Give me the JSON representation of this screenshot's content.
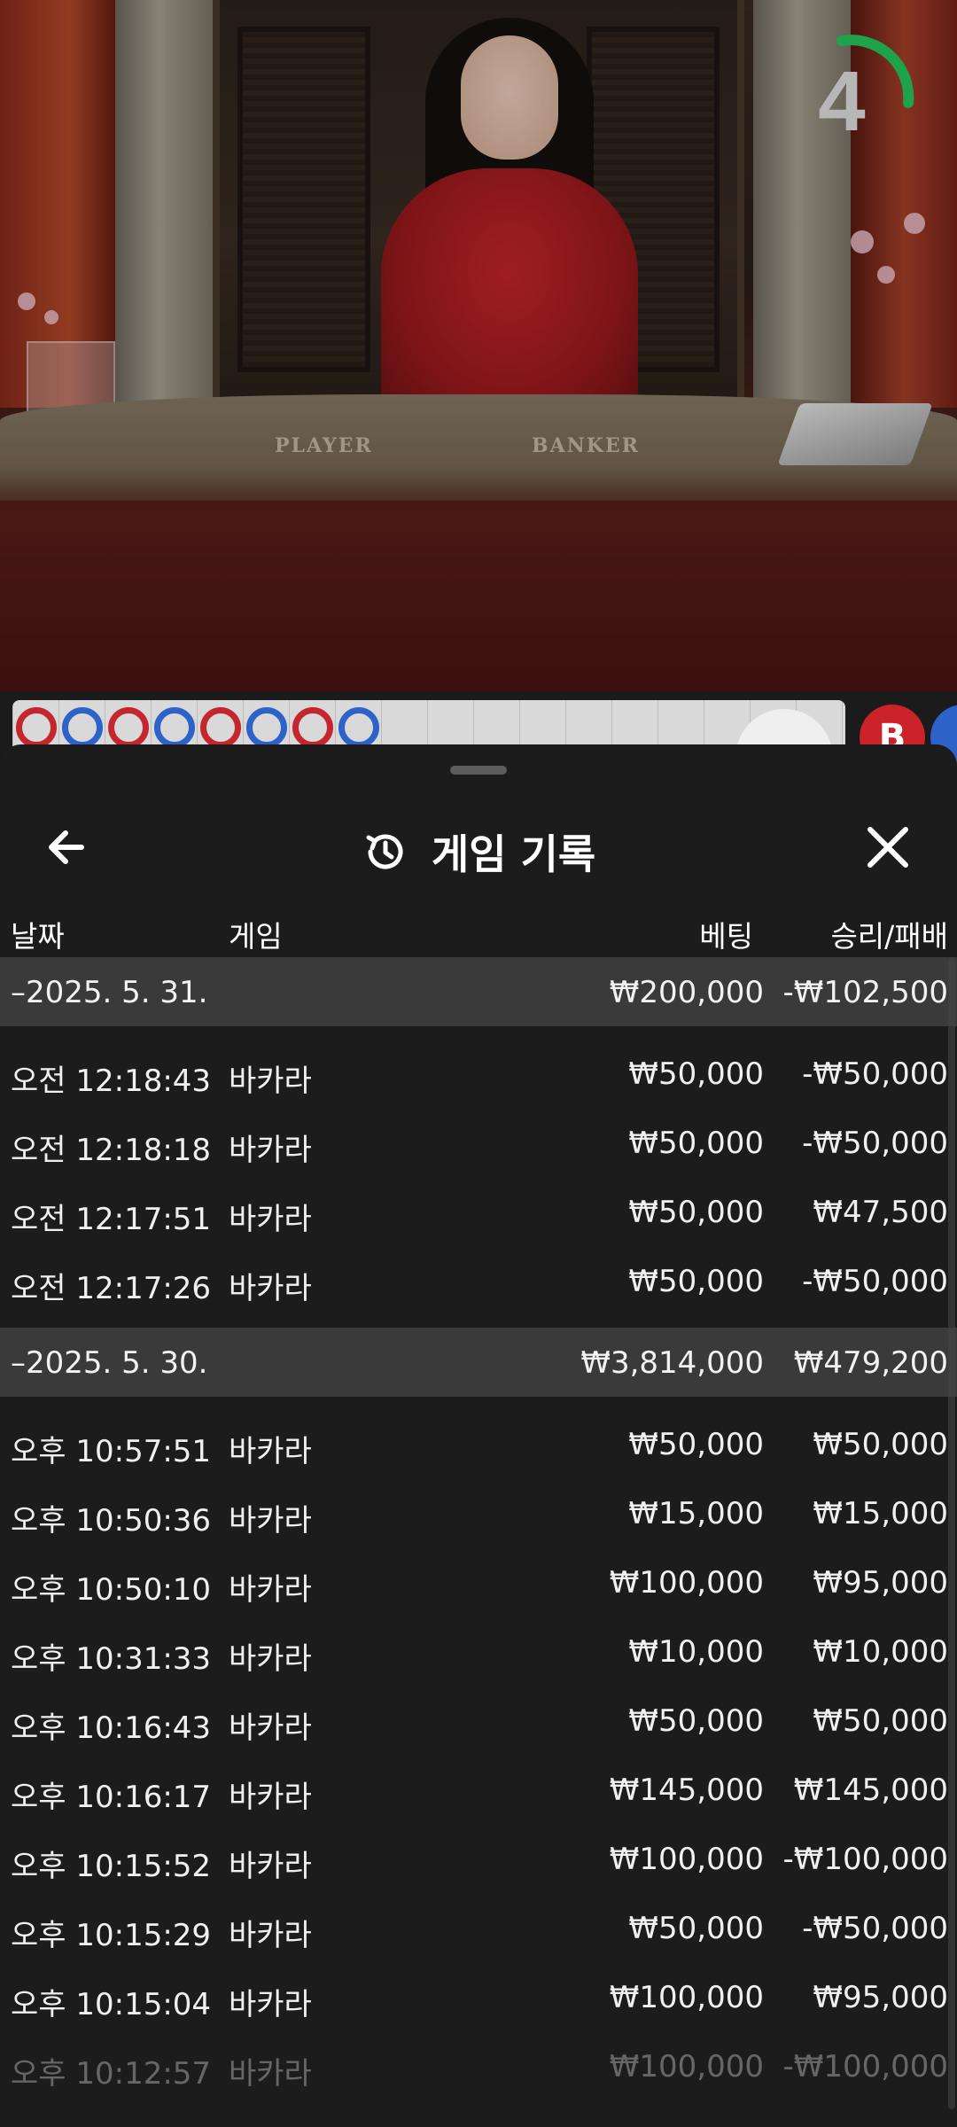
{
  "video": {
    "table_labels": {
      "player": "PLAYER",
      "banker": "BANKER"
    },
    "countdown": "4",
    "timer_color": "#1fa34a"
  },
  "road": {
    "beads": [
      "banker",
      "player",
      "banker",
      "player",
      "banker",
      "player",
      "banker",
      "player"
    ],
    "badge": "B",
    "colors": {
      "banker": "#c4262e",
      "player": "#2d63c8"
    }
  },
  "sheet": {
    "title": "게임 기록",
    "icons": {
      "back": "arrow-left-icon",
      "history": "history-icon",
      "close": "close-icon"
    },
    "columns": {
      "date": "날짜",
      "game": "게임",
      "bet": "베팅",
      "result": "승리/패배"
    },
    "groups": [
      {
        "date": "–2025. 5. 31.",
        "bet": "₩200,000",
        "result": "-₩102,500",
        "rows": [
          {
            "time": "오전 12:18:43",
            "game": "바카라",
            "bet": "₩50,000",
            "result": "-₩50,000"
          },
          {
            "time": "오전 12:18:18",
            "game": "바카라",
            "bet": "₩50,000",
            "result": "-₩50,000"
          },
          {
            "time": "오전 12:17:51",
            "game": "바카라",
            "bet": "₩50,000",
            "result": "₩47,500"
          },
          {
            "time": "오전 12:17:26",
            "game": "바카라",
            "bet": "₩50,000",
            "result": "-₩50,000"
          }
        ]
      },
      {
        "date": "–2025. 5. 30.",
        "bet": "₩3,814,000",
        "result": "₩479,200",
        "rows": [
          {
            "time": "오후 10:57:51",
            "game": "바카라",
            "bet": "₩50,000",
            "result": "₩50,000"
          },
          {
            "time": "오후 10:50:36",
            "game": "바카라",
            "bet": "₩15,000",
            "result": "₩15,000"
          },
          {
            "time": "오후 10:50:10",
            "game": "바카라",
            "bet": "₩100,000",
            "result": "₩95,000"
          },
          {
            "time": "오후 10:31:33",
            "game": "바카라",
            "bet": "₩10,000",
            "result": "₩10,000"
          },
          {
            "time": "오후 10:16:43",
            "game": "바카라",
            "bet": "₩50,000",
            "result": "₩50,000"
          },
          {
            "time": "오후 10:16:17",
            "game": "바카라",
            "bet": "₩145,000",
            "result": "₩145,000"
          },
          {
            "time": "오후 10:15:52",
            "game": "바카라",
            "bet": "₩100,000",
            "result": "-₩100,000"
          },
          {
            "time": "오후 10:15:29",
            "game": "바카라",
            "bet": "₩50,000",
            "result": "-₩50,000"
          },
          {
            "time": "오후 10:15:04",
            "game": "바카라",
            "bet": "₩100,000",
            "result": "₩95,000"
          },
          {
            "time": "오후 10:12:57",
            "game": "바카라",
            "bet": "₩100,000",
            "result": "-₩100,000"
          }
        ]
      }
    ]
  }
}
